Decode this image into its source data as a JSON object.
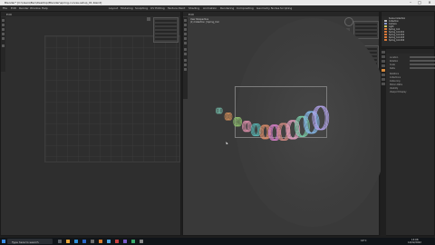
{
  "window": {
    "title": "Blender* [C:\\Users\\Ben\\Desktop\\Blender\\spring-curves-setup_01.blend]",
    "minimize_icon": "minimize-icon",
    "maximize_icon": "maximize-icon",
    "close_icon": "close-icon"
  },
  "menubar": {
    "items": [
      "File",
      "Edit",
      "Render",
      "Window",
      "Help",
      "Layout",
      "Modeling",
      "Sculpting",
      "UV Editing",
      "Texture Paint",
      "Shading",
      "Animation",
      "Rendering",
      "Compositing",
      "Geometry Nodes",
      "Scripting"
    ]
  },
  "left_editor": {
    "header_label": "Edit"
  },
  "viewport": {
    "header_label": "Edit",
    "info_line1": "User Perspective",
    "info_line2": "(1) Collection | Spring_Coil"
  },
  "outliner": {
    "rows": [
      "Scene Collection",
      "Collection",
      "Camera",
      "Light",
      "Spring_Coil",
      "Spring_Coil.001",
      "Spring_Coil.002",
      "Spring_Coil.003",
      "Spring_Coil.004"
    ]
  },
  "properties": {
    "rows": [
      {
        "k": "Location",
        "v": ""
      },
      {
        "k": "Rotation",
        "v": ""
      },
      {
        "k": "Scale",
        "v": ""
      },
      {
        "k": "Delta",
        "v": ""
      },
      {
        "k": "Relations",
        "v": ""
      },
      {
        "k": "Collections",
        "v": ""
      },
      {
        "k": "Instancing",
        "v": ""
      },
      {
        "k": "Motion Paths",
        "v": ""
      },
      {
        "k": "Visibility",
        "v": ""
      },
      {
        "k": "Viewport Display",
        "v": ""
      }
    ]
  },
  "taskbar": {
    "search_placeholder": "Type here to search",
    "temperature": "16°C",
    "clock_time": "13:08",
    "clock_date": "14/02/2022"
  },
  "coils": [
    {
      "color": "#6fb0a0"
    },
    {
      "color": "#c98b5a"
    },
    {
      "color": "#8fc06f"
    },
    {
      "color": "#d98ea8"
    },
    {
      "color": "#58b2b0"
    },
    {
      "color": "#e08f6b"
    },
    {
      "color": "#d57fc6"
    },
    {
      "color": "#cf8a82"
    },
    {
      "color": "#e3a0c0"
    },
    {
      "color": "#79c9a6"
    },
    {
      "color": "#86b8e8"
    },
    {
      "color": "#b0a2e8"
    }
  ]
}
